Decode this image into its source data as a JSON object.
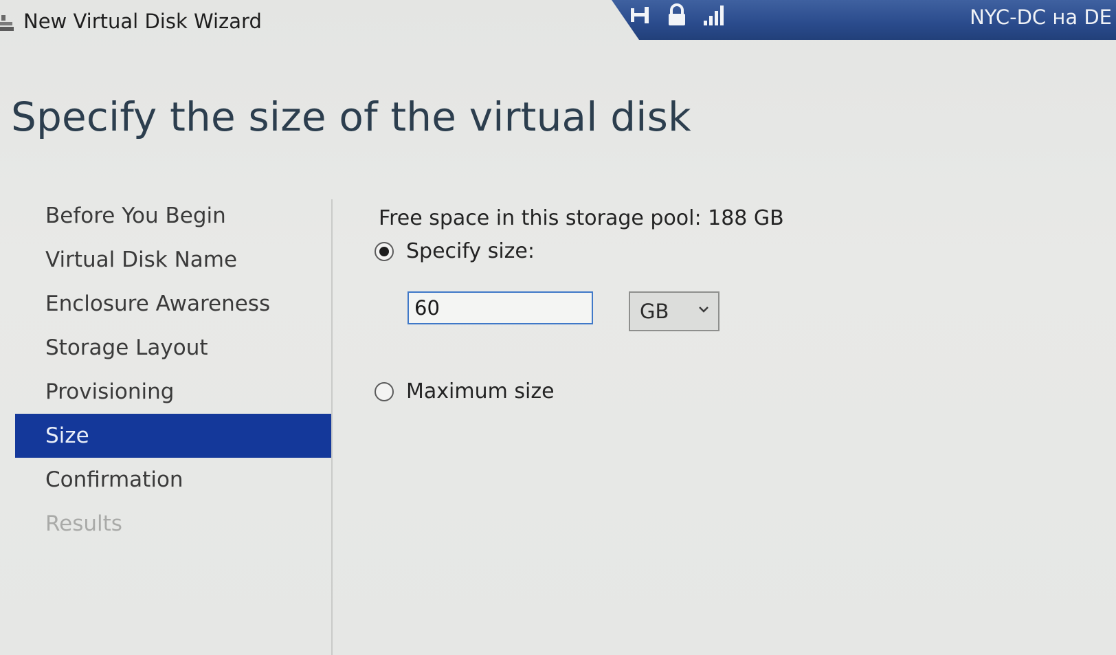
{
  "window": {
    "title": "New Virtual Disk Wizard"
  },
  "rdp_bar": {
    "host_label": "NYC-DC на DE",
    "icons": [
      "pin-icon",
      "lock-icon",
      "signal-icon"
    ]
  },
  "page": {
    "title": "Specify the size of the virtual disk"
  },
  "nav": {
    "items": [
      {
        "label": "Before You Begin",
        "state": "normal"
      },
      {
        "label": "Virtual Disk Name",
        "state": "normal"
      },
      {
        "label": "Enclosure Awareness",
        "state": "normal"
      },
      {
        "label": "Storage Layout",
        "state": "normal"
      },
      {
        "label": "Provisioning",
        "state": "normal"
      },
      {
        "label": "Size",
        "state": "active"
      },
      {
        "label": "Confirmation",
        "state": "normal"
      },
      {
        "label": "Results",
        "state": "disabled"
      }
    ]
  },
  "size_form": {
    "free_space_text": "Free space in this storage pool: 188 GB",
    "specify_size_label": "Specify size:",
    "specify_size_selected": true,
    "size_value": "60",
    "unit_selected": "GB",
    "maximum_size_label": "Maximum size",
    "maximum_size_selected": false
  },
  "colors": {
    "accent_active_nav": "#14389a",
    "rdp_bar": "#2a4b8c",
    "input_border": "#3f78c8"
  }
}
